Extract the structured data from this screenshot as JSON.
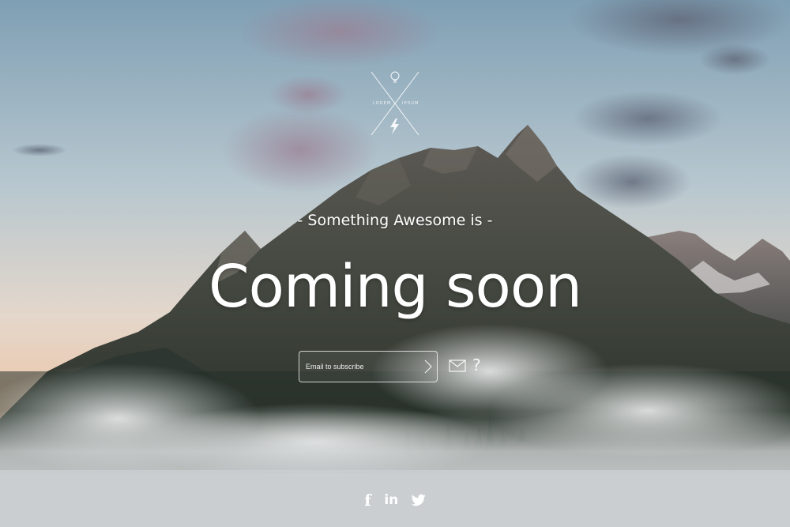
{
  "hero": {
    "tagline": "- Something Awesome is -",
    "headline": "Coming soon"
  },
  "logo": {
    "left_text": "LOREM",
    "right_text": "IPSUM"
  },
  "subscribe": {
    "placeholder": "Email to subscribe"
  },
  "help": {
    "label": "?"
  },
  "social": {
    "facebook": "f",
    "linkedin": "in"
  },
  "icons": {
    "logo": "lightbulb-bolt-logo",
    "submit": "chevron-right-icon",
    "mail": "envelope-icon",
    "help": "question-icon",
    "facebook": "facebook-icon",
    "linkedin": "linkedin-icon",
    "twitter": "twitter-icon"
  },
  "colors": {
    "text": "#ffffff",
    "sky_top": "#8fa7b6",
    "sky_bottom": "#e8c6a8",
    "mountain": "#3d4238",
    "fog": "#d9dcdd"
  }
}
